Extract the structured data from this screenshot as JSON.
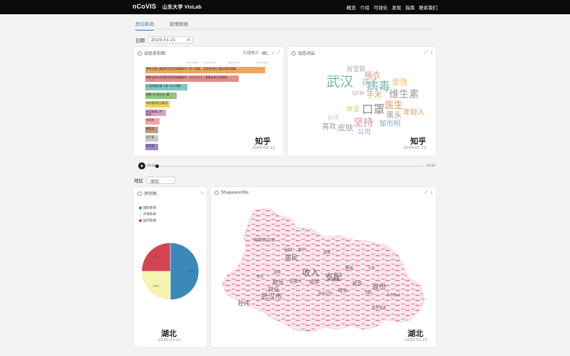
{
  "nav": {
    "brand": "nCoVIS",
    "lab": "山东大学 VisLab",
    "links": [
      "概览",
      "介绍",
      "可视化",
      "发现",
      "指南",
      "联系我们"
    ]
  },
  "tabs": {
    "items": [
      "舆论新闻",
      "疫情数据"
    ],
    "active": 0
  },
  "date_filter": {
    "label": "日期",
    "value": "2020-01-21"
  },
  "bar_panel": {
    "title": "动态条形图",
    "toggle_label": "轮播模式",
    "axis_ticks": [
      "2000,000",
      "4000,000",
      "6000,000",
      "8000,000"
    ],
    "source": "知乎",
    "date": "2020-01-21",
    "bars": [
      {
        "label": "钟南山院士确定新型冠状病毒肺炎人传人现象，北京同时也已确诊病例/事情",
        "value": 1.0,
        "color": "#f2a55a"
      },
      {
        "label": "钟南山院士回答新型冠状病毒肺炎：500个以上，我看未来还会增加",
        "value": 0.78,
        "color": "#e98c8c"
      },
      {
        "label": "2 天的确诊量 公布 180 例新",
        "value": 0.35,
        "color": "#7ec7c2"
      },
      {
        "label": "新增 90 例 SOL 确",
        "value": 0.26,
        "color": "#8dc77e"
      },
      {
        "label": "如何看待武汉新型",
        "value": 0.2,
        "color": "#f0d45a"
      },
      {
        "label": "新冠病毒上传被迫",
        "value": 0.17,
        "color": "#d8a3c7"
      },
      {
        "label": "不如何",
        "value": 0.12,
        "color": "#f3a6a6"
      },
      {
        "label": "新型冠",
        "value": 0.1,
        "color": "#c49a7c"
      },
      {
        "label": "为了医",
        "value": 0.1,
        "color": "#c9c9c9"
      },
      {
        "label": "新冠病",
        "value": 0.09,
        "color": "#9d8ac9"
      }
    ]
  },
  "cloud_panel": {
    "title": "动态词云",
    "source": "知乎",
    "date": "2020-01-21",
    "words": [
      {
        "text": "肖莹颖",
        "size": 9,
        "color": "#b5a9c9"
      },
      {
        "text": "睡衣",
        "size": 11,
        "color": "#e89a8d"
      },
      {
        "text": "武汉",
        "size": 19,
        "color": "#6fb7b0"
      },
      {
        "text": "孩子",
        "size": 11,
        "color": "#86c4a4"
      },
      {
        "text": "爱情",
        "size": 11,
        "color": "#e3c76b"
      },
      {
        "text": "病毒",
        "size": 17,
        "color": "#7eb6ad"
      },
      {
        "text": "VFM",
        "size": 8,
        "color": "#c2a3c7"
      },
      {
        "text": "手术",
        "size": 11,
        "color": "#e8a05a"
      },
      {
        "text": "维生素",
        "size": 14,
        "color": "#9a9a9a"
      },
      {
        "text": "医生",
        "size": 13,
        "color": "#e6935e"
      },
      {
        "text": "体温",
        "size": 9,
        "color": "#e3c76b"
      },
      {
        "text": "口罩",
        "size": 16,
        "color": "#8a8a8a"
      },
      {
        "text": "黑头",
        "size": 11,
        "color": "#9a9a9a"
      },
      {
        "text": "年轻人",
        "size": 10,
        "color": "#e6935e"
      },
      {
        "text": "好评",
        "size": 8,
        "color": "#c2c2c2"
      },
      {
        "text": "坚持",
        "size": 14,
        "color": "#d58aa8"
      },
      {
        "text": "邹市明",
        "size": 10,
        "color": "#86a9d6"
      },
      {
        "text": "喜欢",
        "size": 10,
        "color": "#9a9a9a"
      },
      {
        "text": "皮肤",
        "size": 11,
        "color": "#a0a0a0"
      },
      {
        "text": "公司",
        "size": 9,
        "color": "#86a9d6"
      }
    ]
  },
  "player": {
    "start": "00:00",
    "end": "23:00",
    "progress": 0.0
  },
  "region_filter": {
    "label": "地区",
    "value": "湖北"
  },
  "pie_panel": {
    "title": "饼状图",
    "region": "湖北",
    "date": "2020-01-21",
    "legend": [
      "国际新闻",
      "外地新闻",
      "国内新闻"
    ],
    "colors": [
      "#3a89b8",
      "#f6f2b0",
      "#d24550"
    ],
    "slice_labels": [
      "50%",
      "25%",
      "25%"
    ]
  },
  "shape_panel": {
    "title": "Shapewordle",
    "region": "湖北",
    "date": "2020-01-21",
    "words": [
      {
        "text": "支配",
        "size": 12,
        "color": "#666"
      },
      {
        "text": "收入",
        "size": 12,
        "color": "#666"
      },
      {
        "text": "武汉市",
        "size": 10,
        "color": "#666"
      },
      {
        "text": "省份",
        "size": 10,
        "color": "#666"
      },
      {
        "text": "居民",
        "size": 9,
        "color": "#666"
      },
      {
        "text": "就业",
        "size": 8,
        "color": "#666"
      },
      {
        "text": "救治",
        "size": 8,
        "color": "#666"
      },
      {
        "text": "经纬",
        "size": 8,
        "color": "#666"
      },
      {
        "text": "疫情",
        "size": 7,
        "color": "#666"
      },
      {
        "text": "波音",
        "size": 7,
        "color": "#666"
      },
      {
        "text": "增长",
        "size": 7,
        "color": "#666"
      },
      {
        "text": "国家统计局",
        "size": 6,
        "color": "#666"
      },
      {
        "text": "全国",
        "size": 6,
        "color": "#666"
      },
      {
        "text": "客户",
        "size": 6,
        "color": "#666"
      },
      {
        "text": "数据",
        "size": 5,
        "color": "#666"
      },
      {
        "text": "医院",
        "size": 5,
        "color": "#666"
      },
      {
        "text": "加拿大",
        "size": 6,
        "color": "#666"
      },
      {
        "text": "肺炎",
        "size": 6,
        "color": "#666"
      },
      {
        "text": "飞机",
        "size": 6,
        "color": "#666"
      },
      {
        "text": "表示",
        "size": 5,
        "color": "#666"
      },
      {
        "text": "患者",
        "size": 6,
        "color": "#666"
      },
      {
        "text": "医学报道",
        "size": 5,
        "color": "#666"
      },
      {
        "text": "波音公司",
        "size": 5,
        "color": "#666"
      },
      {
        "text": "工作",
        "size": 5,
        "color": "#666"
      },
      {
        "text": "今日热点",
        "size": 5,
        "color": "#666"
      }
    ]
  }
}
